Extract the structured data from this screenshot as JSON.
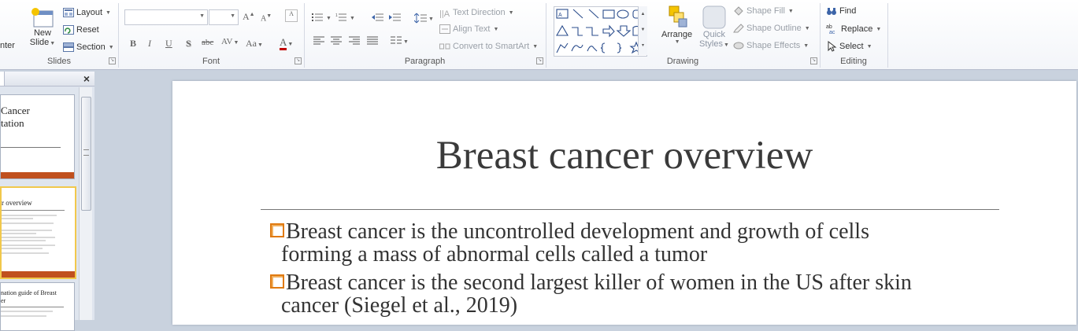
{
  "ribbon": {
    "slides": {
      "label": "Slides",
      "enter_partial": "nter",
      "new_slide_line1": "New",
      "new_slide_line2": "Slide",
      "layout": "Layout",
      "reset": "Reset",
      "section": "Section"
    },
    "font": {
      "label": "Font",
      "bold": "B",
      "italic": "I",
      "underline": "U",
      "shadow": "S",
      "strike": "abc",
      "spacing": "AV",
      "change_case": "Aa",
      "font_color": "A",
      "grow": "A",
      "shrink": "A"
    },
    "paragraph": {
      "label": "Paragraph",
      "text_direction": "Text Direction",
      "align_text": "Align Text",
      "convert_smartart": "Convert to SmartArt"
    },
    "drawing": {
      "label": "Drawing",
      "arrange": "Arrange",
      "quick_styles_line1": "Quick",
      "quick_styles_line2": "Styles",
      "shape_fill": "Shape Fill",
      "shape_outline": "Shape Outline",
      "shape_effects": "Shape Effects"
    },
    "editing": {
      "label": "Editing",
      "find": "Find",
      "replace": "Replace",
      "select": "Select"
    }
  },
  "panel": {
    "close": "×",
    "thumb1": {
      "line1": "Cancer",
      "line2": "tation"
    },
    "thumb2": {
      "title": "r overview"
    },
    "thumb3": {
      "line1": "nation guide of Breast",
      "line2": "er"
    }
  },
  "slide": {
    "title": "Breast cancer overview",
    "bullets": [
      {
        "line1": "Breast cancer is the uncontrolled development and growth of cells",
        "line2": "forming a mass of abnormal cells called a tumor"
      },
      {
        "line1": "Breast cancer is the second largest killer of women in the US after skin",
        "line2": "cancer (Siegel et al., 2019)"
      }
    ]
  },
  "colors": {
    "accent_orange": "#e07a10",
    "thumb_bar": "#c0501e",
    "selection": "#f1c84c"
  }
}
